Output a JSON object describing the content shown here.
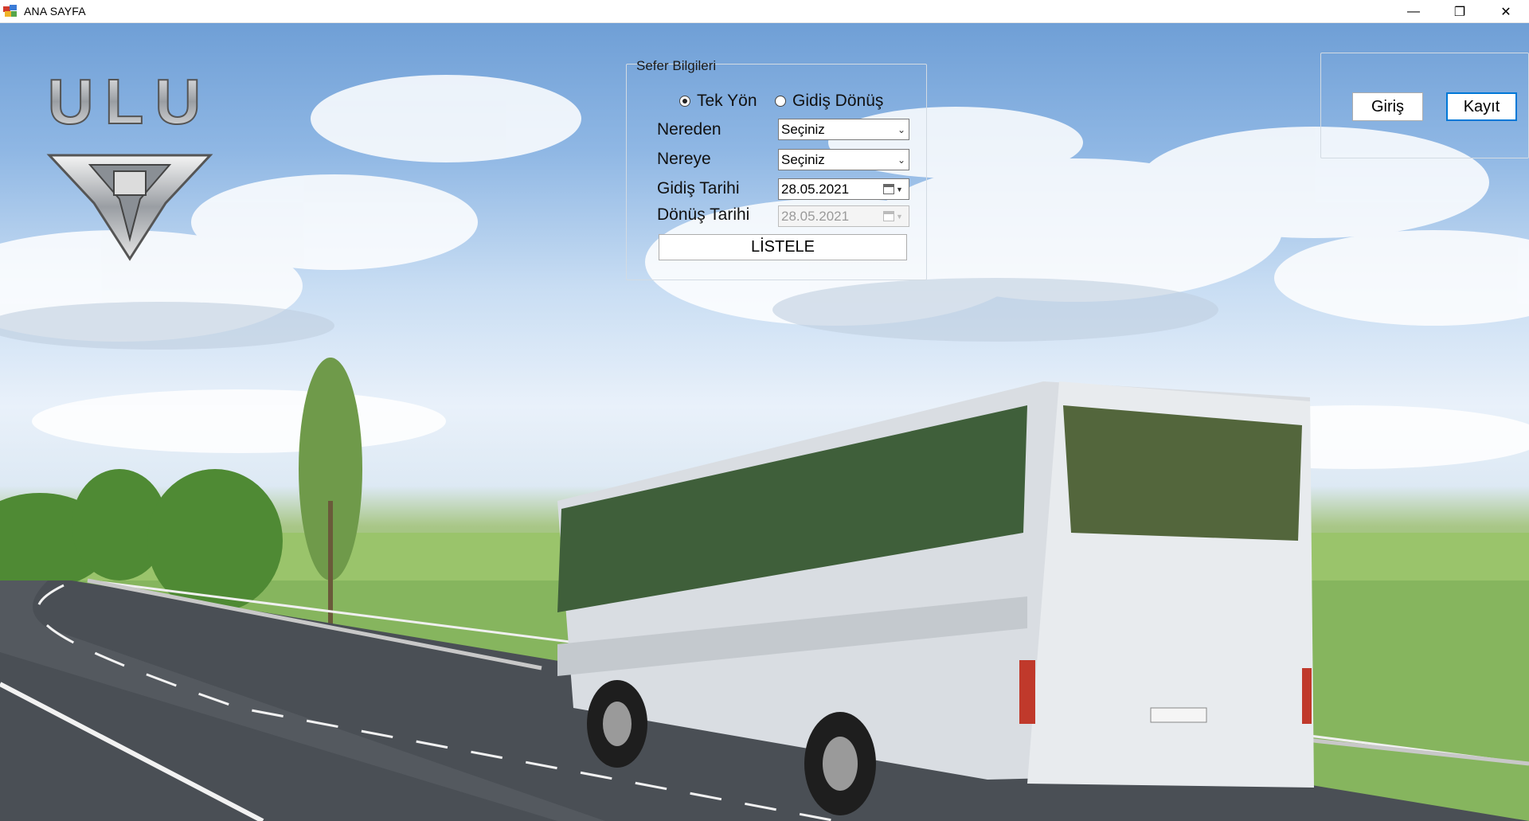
{
  "window": {
    "title": "ANA SAYFA",
    "controls": {
      "minimize": "—",
      "restore": "❐",
      "close": "✕"
    }
  },
  "logo": {
    "text": "ULU"
  },
  "trip": {
    "group_title": "Sefer Bilgileri",
    "one_way_label": "Tek Yön",
    "round_trip_label": "Gidiş Dönüş",
    "selected": "one_way",
    "from_label": "Nereden",
    "from_value": "Seçiniz",
    "to_label": "Nereye",
    "to_value": "Seçiniz",
    "depart_label": "Gidiş Tarihi",
    "depart_date": "28.05.2021",
    "return_label": "Dönüş Tarihi",
    "return_date": "28.05.2021",
    "return_enabled": false,
    "list_button": "LİSTELE"
  },
  "auth": {
    "login_button": "Giriş",
    "register_button": "Kayıt"
  },
  "colors": {
    "accent": "#0078d7",
    "sky": "#8fb7e4",
    "grass": "#86b55e",
    "road": "#4a4f55"
  }
}
